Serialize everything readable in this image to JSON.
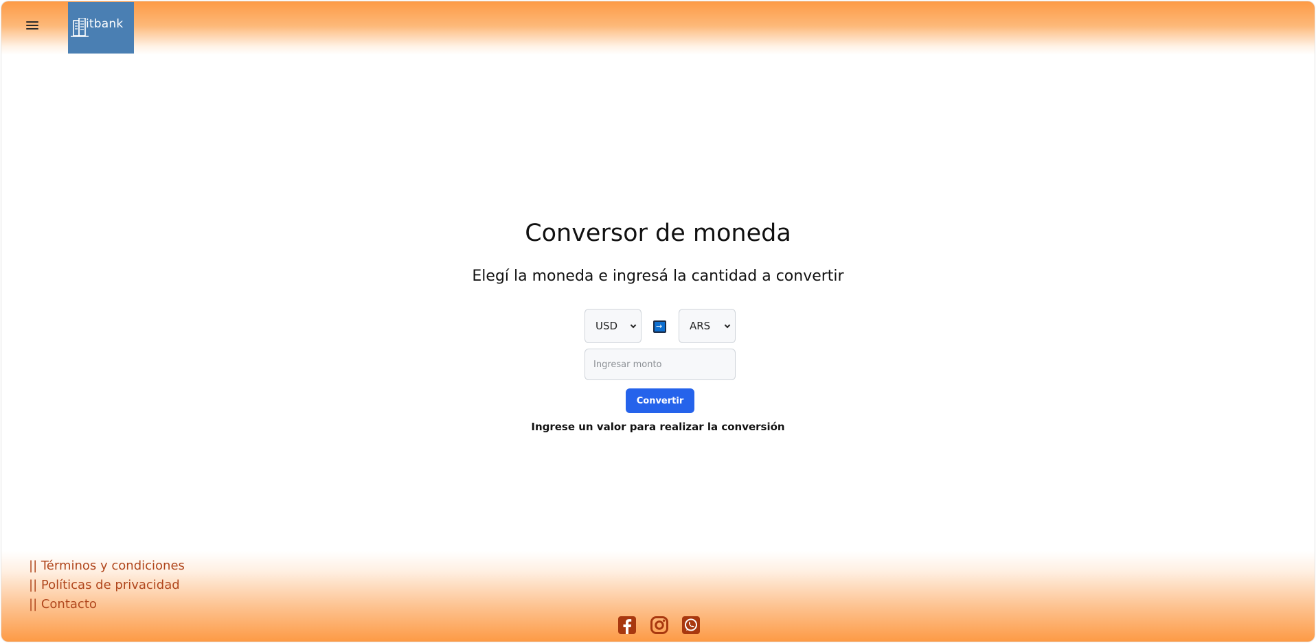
{
  "header": {
    "logo_text": "itbank"
  },
  "main": {
    "title": "Conversor de moneda",
    "subtitle": "Elegí la moneda e ingresá la cantidad a convertir",
    "from_currency": "USD",
    "to_currency": "ARS",
    "swap_symbol": "→",
    "amount_placeholder": "Ingresar monto",
    "convert_label": "Convertir",
    "result_text": "Ingrese un valor para realizar la conversión"
  },
  "footer": {
    "links": [
      "|| Términos y condiciones",
      "|| Políticas de privacidad",
      "|| Contacto"
    ],
    "social_icons": [
      "facebook-icon",
      "instagram-icon",
      "whatsapp-icon"
    ]
  },
  "colors": {
    "header_orange": "#fd9a45",
    "logo_blue": "#4a7fb3",
    "button_blue": "#2563eb",
    "link_color": "#b0461c",
    "social_icon_color": "#a8380f"
  }
}
